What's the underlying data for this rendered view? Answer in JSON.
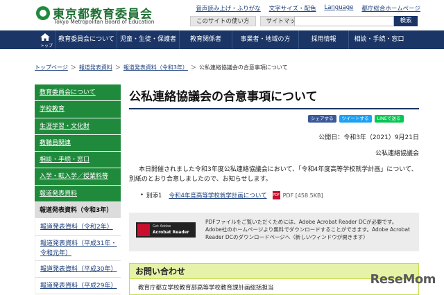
{
  "header": {
    "site_title": "東京都教育委員会",
    "site_subtitle": "Tokyo Metropolitan Board of Education",
    "util_links": [
      "音声読み上げ・ふりがな",
      "文字サイズ・配色",
      "Language",
      "都庁総合ホームページ"
    ],
    "util_buttons": [
      "このサイトの使い方",
      "サイトマップ"
    ],
    "search_placeholder": "",
    "search_label": "検索"
  },
  "gnav": {
    "home_label": "トップ",
    "items": [
      "教育委員会について",
      "児童・生徒・保護者",
      "教育関係者",
      "事業者・地域の方",
      "採用情報",
      "相談・手続・窓口"
    ]
  },
  "breadcrumb": {
    "items": [
      "トップページ",
      "報道発表資料",
      "報道発表資料（令和3年）"
    ],
    "current": "公私連絡協議会の合意事項について",
    "sep": "＞"
  },
  "sidebar": {
    "items": [
      {
        "label": "教育委員会について",
        "kind": "green"
      },
      {
        "label": "学校教育",
        "kind": "green"
      },
      {
        "label": "生涯学習・文化財",
        "kind": "green"
      },
      {
        "label": "教職員関連",
        "kind": "green"
      },
      {
        "label": "相談・手続・窓口",
        "kind": "green"
      },
      {
        "label": "入学・転入学／授業料等",
        "kind": "green"
      },
      {
        "label": "報道発表資料",
        "kind": "green"
      },
      {
        "label": "報道発表資料（令和3年）",
        "kind": "current"
      },
      {
        "label": "報道発表資料（令和2年）",
        "kind": "sub"
      },
      {
        "label": "報道発表資料（平成31年・令和元年）",
        "kind": "sub-two"
      },
      {
        "label": "報道発表資料（平成30年）",
        "kind": "sub"
      },
      {
        "label": "報道発表資料（平成29年）",
        "kind": "sub"
      }
    ]
  },
  "main": {
    "title": "公私連絡協議会の合意事項について",
    "share": {
      "facebook": "シェアする",
      "twitter": "ツイートする",
      "line": "LINEで送る"
    },
    "published": "公開日：令和3年（2021）9月21日",
    "org": "公私連絡協議会",
    "body": "本日開催されました令和3年度公私連絡協議会において、「令和4年度高等学校就学計画」について、別紙のとおり合意しましたので、お知らせします。",
    "attachment": {
      "prefix": "別添1",
      "link": "令和4年度高等学校就学計画について",
      "type": "PDF",
      "size": "PDF [458.5KB]"
    },
    "acrobat": {
      "badge_small": "Get Adobe",
      "badge_big": "Acrobat Reader",
      "text": "PDFファイルをご覧いただくためには、Adobe Acrobat Reader DCが必要です。Adobe社のホームページより無料でダウンロードすることができます。Adobe Acrobat Reader DCのダウンロードページへ（新しいウィンドウが開きます）"
    },
    "contact": {
      "heading": "お問い合わせ",
      "dept": "教育庁都立学校教育部高等学校教育課計画総括担当"
    }
  },
  "watermark": "ReseMom",
  "colors": {
    "nav": "#1a3566",
    "sidebar_green": "#1f8a3b",
    "contact_bg": "#e6f2a8"
  }
}
